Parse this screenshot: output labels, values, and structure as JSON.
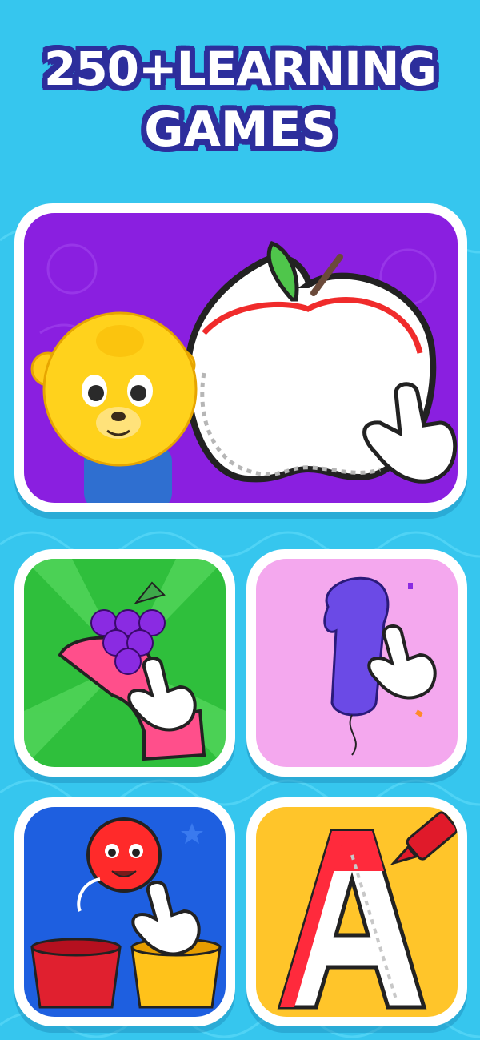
{
  "headline": {
    "line1": "250+LEARNING",
    "line2": "GAMES"
  },
  "colors": {
    "background": "#36c6ee",
    "headline_text": "#ffffff",
    "headline_outline": "#2d2e9c",
    "card_border": "#ffffff"
  },
  "cards": [
    {
      "id": "tracing-apple",
      "icons": [
        "bear-mascot-icon",
        "apple-outline-icon",
        "pointing-hand-icon"
      ],
      "background": "#8a1fe0"
    },
    {
      "id": "number-grapes",
      "icons": [
        "grapes-icon",
        "number-shape-icon",
        "pointing-hand-icon"
      ],
      "background": "#2fbf3c"
    },
    {
      "id": "number-balloon",
      "icons": [
        "number-one-balloon-icon",
        "pointing-hand-icon"
      ],
      "background": "#f4a8ee"
    },
    {
      "id": "color-sorting",
      "icons": [
        "red-ball-face-icon",
        "red-basket-icon",
        "yellow-basket-icon",
        "pointing-hand-icon"
      ],
      "background": "#1e5fe0"
    },
    {
      "id": "letter-tracing",
      "icons": [
        "letter-a-icon",
        "crayon-icon"
      ],
      "background": "#ffc52a"
    }
  ]
}
